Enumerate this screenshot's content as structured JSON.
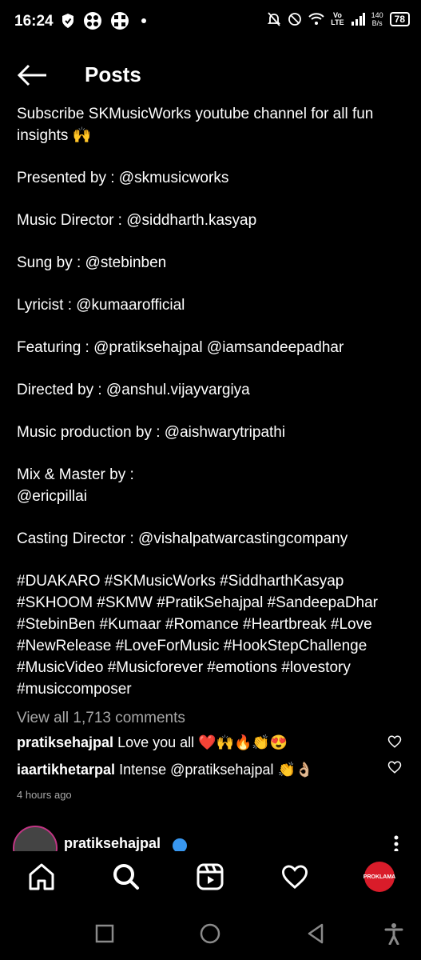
{
  "status_bar": {
    "time": "16:24",
    "network_top": "Vo",
    "network_bottom": "LTE",
    "speed_value": "140",
    "speed_unit": "B/s",
    "battery": "78"
  },
  "header": {
    "title": "Posts"
  },
  "caption": {
    "intro": "Subscribe SKMusicWorks youtube channel for all fun insights 🙌",
    "presented": "Presented by : @skmusicworks",
    "music_director": "Music Director : @siddharth.kasyap",
    "sung": "Sung by : @stebinben",
    "lyricist": "Lyricist : @kumaarofficial",
    "featuring": "Featuring : @pratiksehajpal @iamsandeepadhar",
    "directed": "Directed by : @anshul.vijayvargiya",
    "production": "Music production by : @aishwarytripathi",
    "mix_label": "Mix & Master by :",
    "mix_handle": "@ericpillai",
    "casting": "Casting Director : @vishalpatwarcastingcompany",
    "hashtags": "#DUAKARO #SKMusicWorks #SiddharthKasyap #SKHOOM #SKMW #PratikSehajpal #SandeepaDhar #StebinBen #Kumaar #Romance #Heartbreak #Love #NewRelease #LoveForMusic #HookStepChallenge #MusicVideo #Musicforever #emotions #lovestory #musiccomposer"
  },
  "comments": {
    "view_all": "View all 1,713 comments",
    "items": [
      {
        "user": "pratiksehajpal",
        "text": "Love you all ❤️🙌🔥👏😍"
      },
      {
        "user": "iaartikhetarpal",
        "text": "Intense @pratiksehajpal 👏👌🏼"
      }
    ],
    "time_ago": "4 hours ago"
  },
  "next_post": {
    "username": "pratiksehajpal"
  },
  "bottom_nav": {
    "profile_label": "PROKLAMA"
  },
  "colors": {
    "background": "#000000",
    "muted": "#a8a8a8",
    "verified": "#3897f0",
    "heart_red": "#ed4956"
  }
}
